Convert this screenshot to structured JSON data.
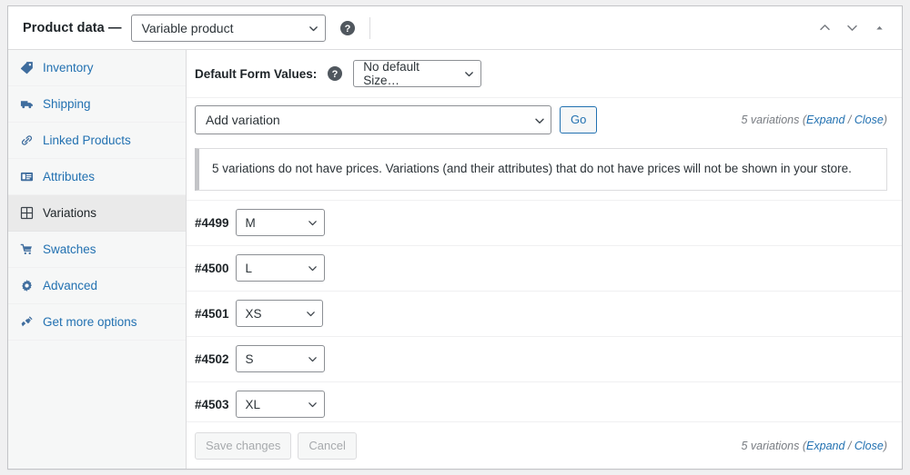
{
  "header": {
    "title": "Product data —",
    "product_type": "Variable product",
    "help_icon": "help-icon",
    "move_up_icon": "chevron-up-icon",
    "move_down_icon": "chevron-down-icon",
    "toggle_icon": "triangle-up-icon"
  },
  "sidebar": {
    "items": [
      {
        "label": "Inventory",
        "icon": "tag-icon",
        "active": false
      },
      {
        "label": "Shipping",
        "icon": "truck-icon",
        "active": false
      },
      {
        "label": "Linked Products",
        "icon": "link-icon",
        "active": false
      },
      {
        "label": "Attributes",
        "icon": "list-icon",
        "active": false
      },
      {
        "label": "Variations",
        "icon": "grid-icon",
        "active": true
      },
      {
        "label": "Swatches",
        "icon": "cart-icon",
        "active": false
      },
      {
        "label": "Advanced",
        "icon": "gear-icon",
        "active": false
      },
      {
        "label": "Get more options",
        "icon": "plugin-icon",
        "active": false
      }
    ]
  },
  "defaults": {
    "label": "Default Form Values:",
    "help_icon": "help-icon",
    "size_select_value": "No default Size…"
  },
  "toolbar": {
    "add_variation_value": "Add variation",
    "go_label": "Go",
    "count_text": "5 variations",
    "expand_label": "Expand",
    "separator": "/",
    "close_label": "Close"
  },
  "notice": {
    "message": "5 variations do not have prices. Variations (and their attributes) that do not have prices will not be shown in your store."
  },
  "variations": [
    {
      "id": "#4499",
      "size": "M"
    },
    {
      "id": "#4500",
      "size": "L"
    },
    {
      "id": "#4501",
      "size": "XS"
    },
    {
      "id": "#4502",
      "size": "S"
    },
    {
      "id": "#4503",
      "size": "XL"
    }
  ],
  "footer": {
    "save_label": "Save changes",
    "cancel_label": "Cancel",
    "count_text": "5 variations",
    "expand_label": "Expand",
    "separator": "/",
    "close_label": "Close"
  },
  "colors": {
    "link": "#2271b1",
    "text": "#1d2327",
    "muted": "#787c82",
    "panel_border": "#c3c4c7",
    "sidebar_bg": "#f6f7f7",
    "active_bg": "#eaeaea"
  }
}
